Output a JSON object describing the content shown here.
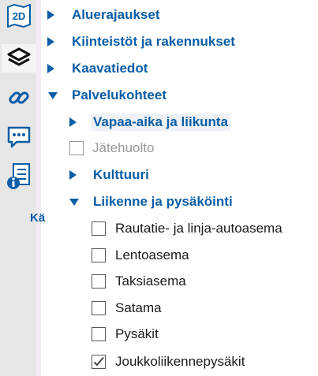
{
  "rail": {
    "items": [
      {
        "icon": "map-2d-icon",
        "label": "2D"
      },
      {
        "icon": "layers-icon"
      },
      {
        "icon": "link-icon"
      },
      {
        "icon": "chat-icon"
      },
      {
        "icon": "legend-info-icon"
      }
    ],
    "cut_text": "Kä"
  },
  "tree": {
    "groups": [
      {
        "label": "Aluerajaukset",
        "expanded": false
      },
      {
        "label": "Kiinteistöt ja rakennukset",
        "expanded": false
      },
      {
        "label": "Kaavatiedot",
        "expanded": false
      },
      {
        "label": "Palvelukohteet",
        "expanded": true,
        "children": [
          {
            "label": "Vapaa-aika ja liikunta",
            "type": "group",
            "expanded": false,
            "highlighted": true
          },
          {
            "label": "Jätehuolto",
            "type": "checkbox",
            "checked": false,
            "disabled": true
          },
          {
            "label": "Kulttuuri",
            "type": "group",
            "expanded": false
          },
          {
            "label": "Liikenne ja pysäköinti",
            "type": "group",
            "expanded": true,
            "children": [
              {
                "label": "Rautatie- ja linja-autoasema",
                "checked": false
              },
              {
                "label": "Lentoasema",
                "checked": false
              },
              {
                "label": "Taksiasema",
                "checked": false
              },
              {
                "label": "Satama",
                "checked": false
              },
              {
                "label": "Pysäkit",
                "checked": false
              },
              {
                "label": "Joukkoliikennepysäkit",
                "checked": true
              }
            ]
          }
        ]
      }
    ]
  },
  "colors": {
    "accent": "#0a5da6",
    "text": "#1a1a1a",
    "disabled": "#9a9a9a"
  }
}
